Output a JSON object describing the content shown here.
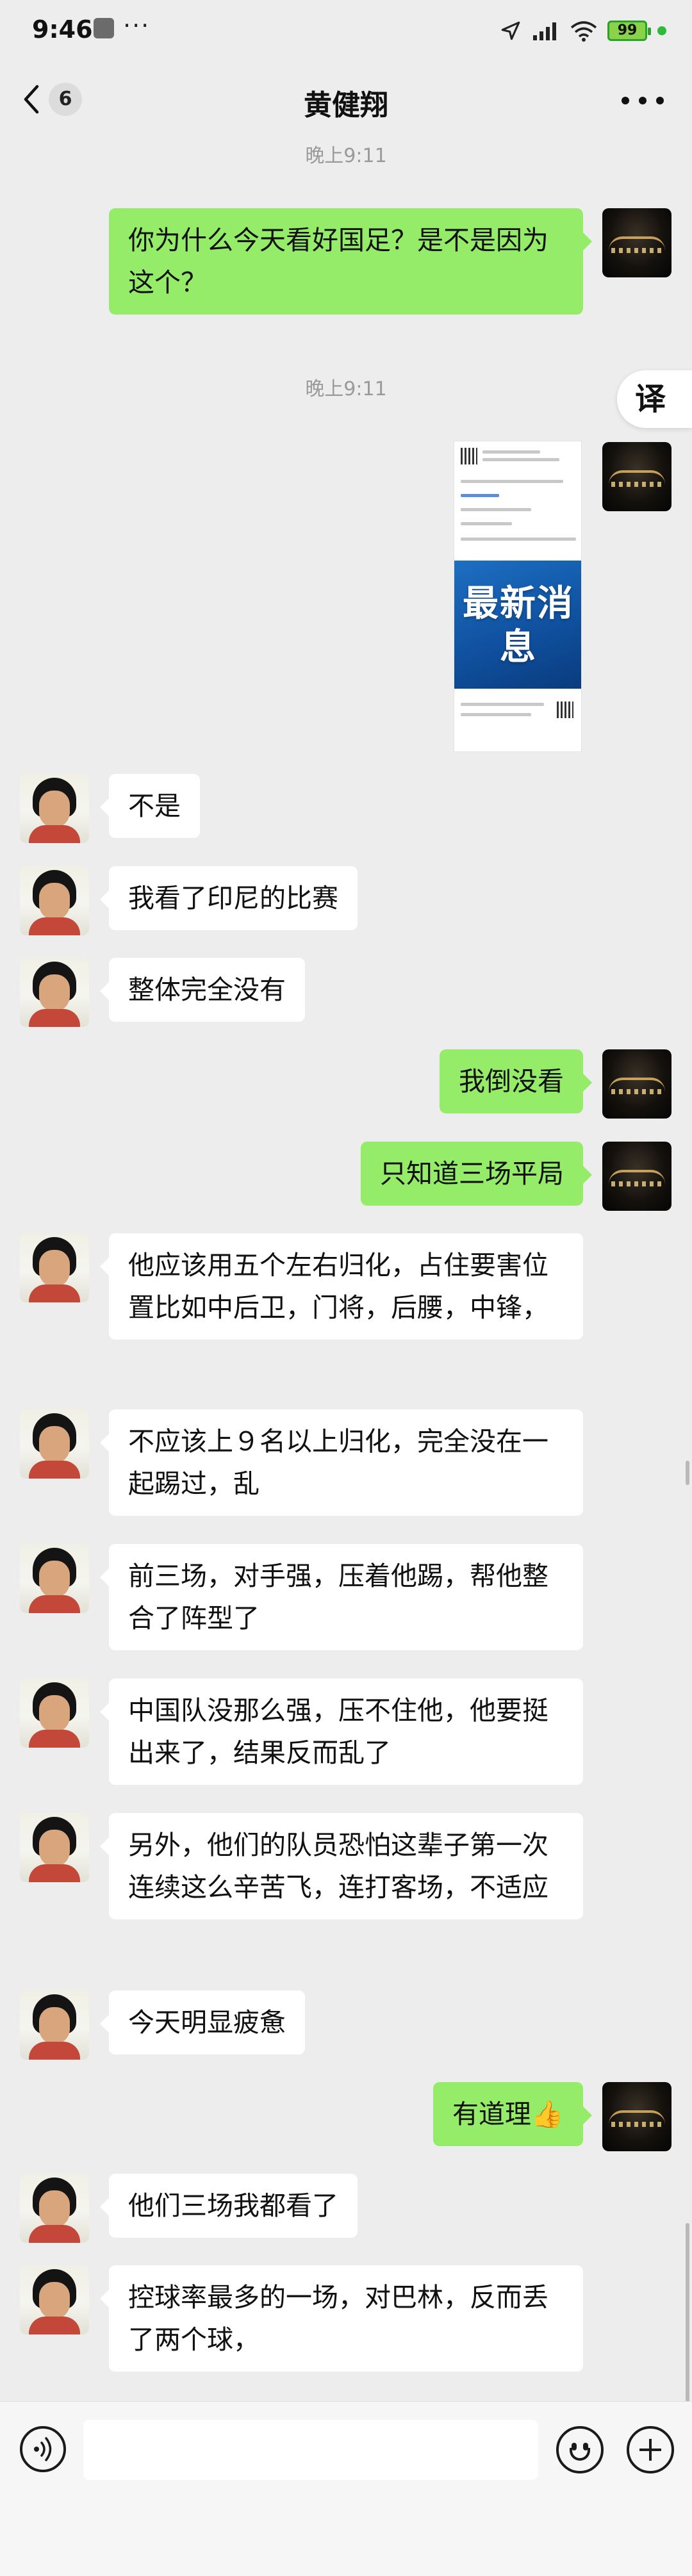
{
  "status_bar": {
    "time": "9:46",
    "dots": "···",
    "battery": "99"
  },
  "nav": {
    "unread_count": "6",
    "title": "黄健翔"
  },
  "translate_label": "译",
  "timestamps": [
    "晚上9:11",
    "晚上9:11"
  ],
  "image_message": {
    "banner_text": "最新消息"
  },
  "messages": [
    {
      "side": "right",
      "text": "你为什么今天看好国足？是不是因为这个？"
    },
    {
      "side": "left",
      "text": "不是"
    },
    {
      "side": "left",
      "text": "我看了印尼的比赛"
    },
    {
      "side": "left",
      "text": "整体完全没有"
    },
    {
      "side": "right",
      "text": "我倒没看"
    },
    {
      "side": "right",
      "text": "只知道三场平局"
    },
    {
      "side": "left",
      "text": "他应该用五个左右归化，占住要害位置比如中后卫，门将，后腰，中锋，"
    },
    {
      "side": "left",
      "text": "不应该上９名以上归化，完全没在一起踢过，乱"
    },
    {
      "side": "left",
      "text": "前三场，对手强，压着他踢，帮他整合了阵型了"
    },
    {
      "side": "left",
      "text": "中国队没那么强，压不住他，他要挺出来了，结果反而乱了"
    },
    {
      "side": "left",
      "text": "另外，他们的队员恐怕这辈子第一次连续这么辛苦飞，连打客场，不适应"
    },
    {
      "side": "left",
      "text": "今天明显疲惫"
    },
    {
      "side": "right",
      "text": "有道理👍"
    },
    {
      "side": "left",
      "text": "他们三场我都看了"
    },
    {
      "side": "left",
      "text": "控球率最多的一场，对巴林，反而丢了两个球，"
    }
  ],
  "input": {
    "value": "",
    "placeholder": ""
  },
  "icons": {
    "back": "chevron-left-icon",
    "more": "more-dots-icon",
    "voice": "voice-icon",
    "emoji": "emoji-icon",
    "plus": "plus-icon"
  },
  "colors": {
    "self_bubble": "#95ec69",
    "other_bubble": "#ffffff",
    "background": "#ededed"
  }
}
